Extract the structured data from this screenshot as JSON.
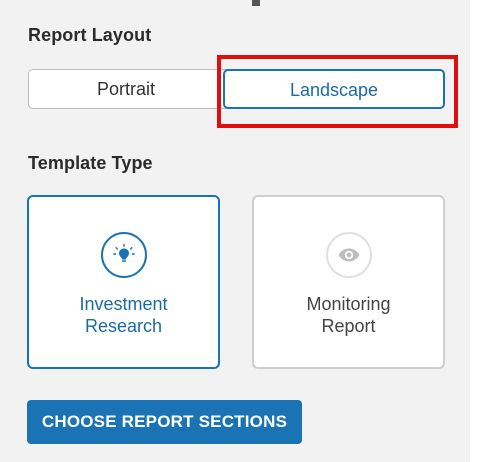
{
  "report_layout": {
    "heading": "Report Layout",
    "options": [
      {
        "label": "Portrait",
        "selected": false
      },
      {
        "label": "Landscape",
        "selected": true
      }
    ]
  },
  "template_type": {
    "heading": "Template Type",
    "cards": [
      {
        "line1": "Investment",
        "line2": "Research",
        "icon": "lightbulb-icon",
        "selected": true
      },
      {
        "line1": "Monitoring",
        "line2": "Report",
        "icon": "eye-icon",
        "selected": false
      }
    ]
  },
  "actions": {
    "choose_sections_label": "CHOOSE REPORT SECTIONS"
  },
  "colors": {
    "accent": "#1a73b4",
    "highlight": "#e20e0e",
    "background": "#f2f2f2"
  }
}
